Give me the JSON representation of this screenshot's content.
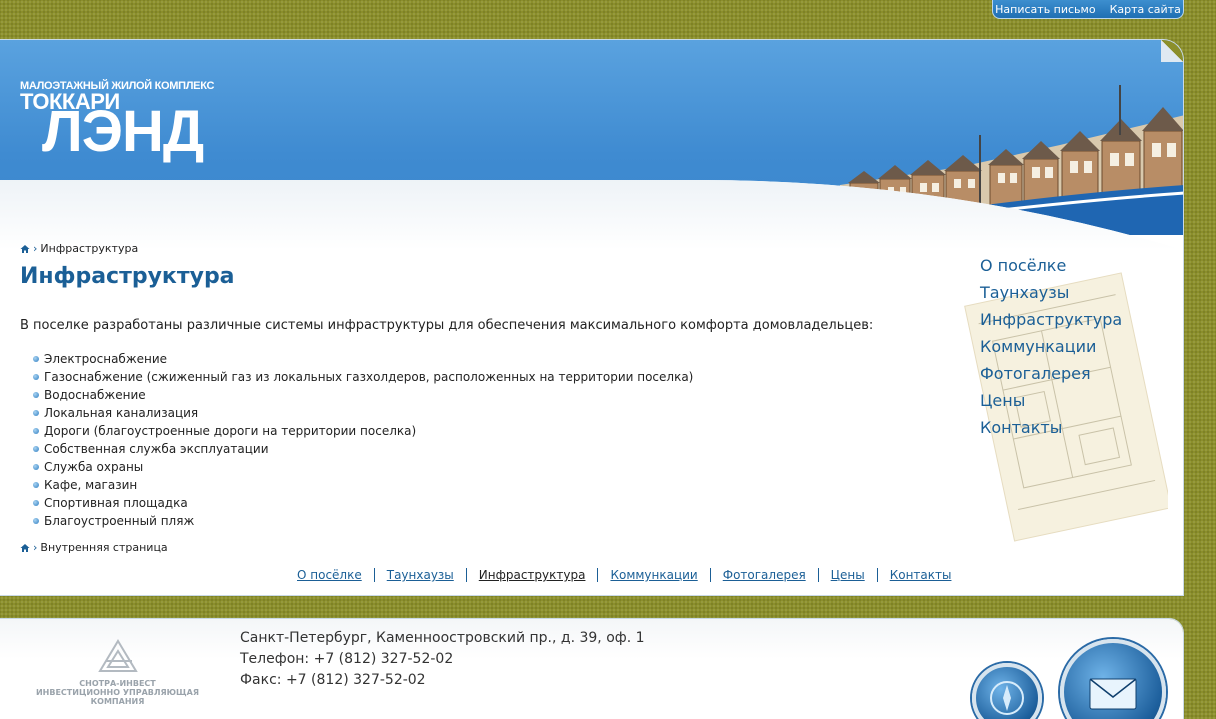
{
  "top_links": [
    "Написать письмо",
    "Карта сайта"
  ],
  "logo": {
    "tagline": "МАЛОЭТАЖНЫЙ ЖИЛОЙ КОМПЛЕКС",
    "line1": "ТОККАРИ",
    "line2": "ЛЭНД"
  },
  "breadcrumb": {
    "current": "Инфраструктура"
  },
  "page_title": "Инфраструктура",
  "intro": "В поселке разработаны различные системы инфраструктуры для обеспечения максимального комфорта домовладельцев:",
  "features": [
    "Электроснабжение",
    "Газоснабжение (сжиженный газ из локальных газхолдеров, расположенных на территории поселка)",
    "Водоснабжение",
    "Локальная канализация",
    "Дороги (благоустроенные дороги на территории поселка)",
    "Собственная служба эксплуатации",
    "Служба охраны",
    "Кафе, магазин",
    "Спортивная площадка",
    "Благоустроенный пляж"
  ],
  "bottom_breadcrumb": "Внутренняя страница",
  "side_nav": [
    "О посёлке",
    "Таунхаузы",
    "Инфраструктура",
    "Коммункации",
    "Фотогалерея",
    "Цены",
    "Контакты"
  ],
  "bottom_nav": [
    "О посёлке",
    "Таунхаузы",
    "Инфраструктура",
    "Коммункации",
    "Фотогалерея",
    "Цены",
    "Контакты"
  ],
  "bottom_nav_active": "Инфраструктура",
  "footer": {
    "company_name": "СНОТРА-ИНВЕСТ",
    "company_sub": "ИНВЕСТИЦИОННО УПРАВЛЯЮЩАЯ КОМПАНИЯ",
    "address": "Санкт-Петербург, Каменноостровский пр., д. 39, оф. 1",
    "phone": "Телефон: +7 (812) 327-52-02",
    "fax": "Факс: +7 (812) 327-52-02"
  },
  "colors": {
    "link": "#1b5f96",
    "header_blue": "#3f8bd1",
    "olive_background": "#8b8f2b"
  },
  "icons": [
    "home-icon",
    "compass-icon",
    "mail-icon"
  ]
}
